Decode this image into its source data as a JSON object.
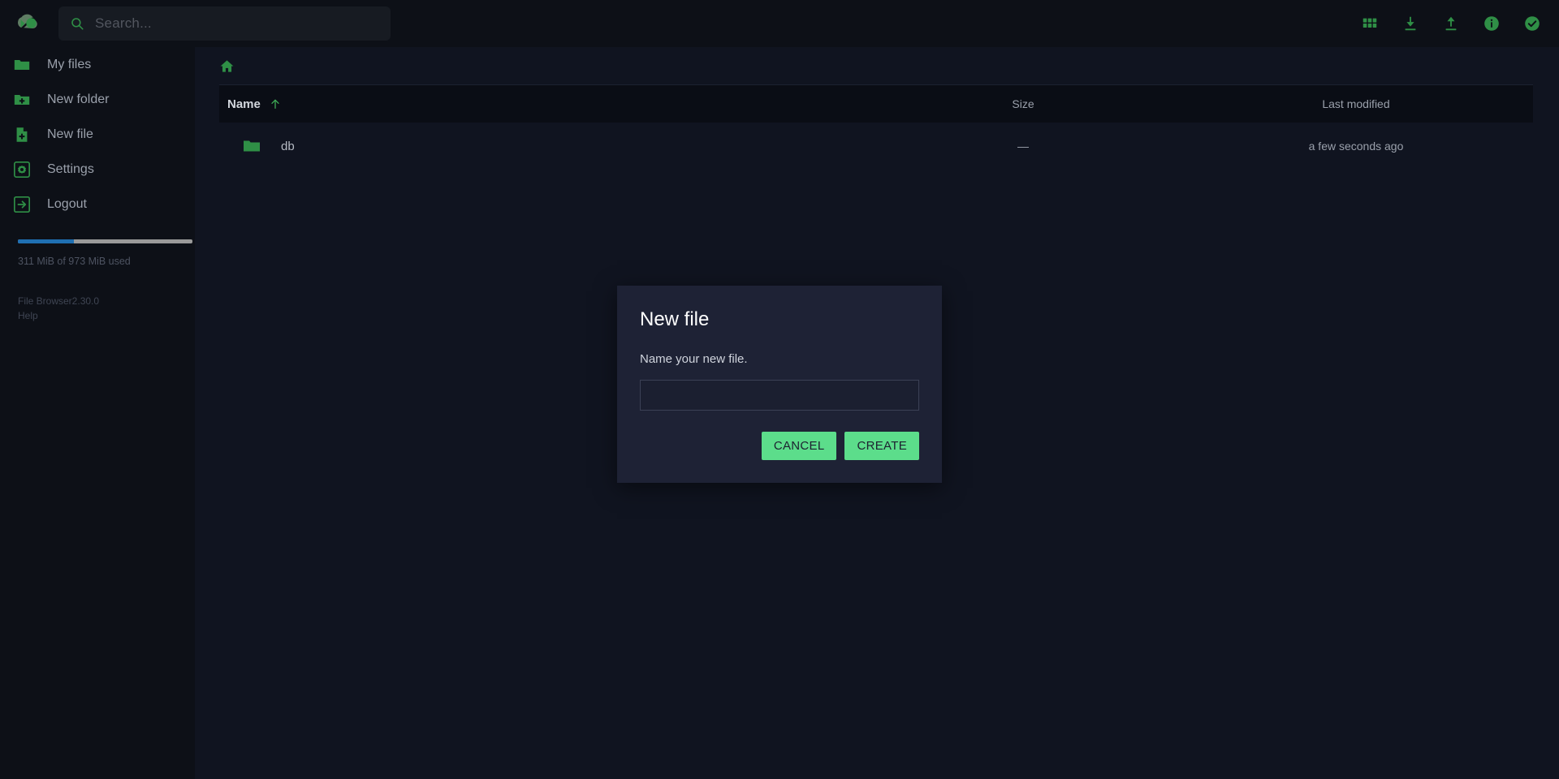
{
  "header": {
    "logo_name": "file-browser-logo",
    "search": {
      "placeholder": "Search...",
      "value": ""
    },
    "actions": [
      {
        "name": "switch-view-button",
        "icon": "grid-icon",
        "label": "Switch view"
      },
      {
        "name": "download-button",
        "icon": "download-icon",
        "label": "Download"
      },
      {
        "name": "upload-button",
        "icon": "upload-icon",
        "label": "Upload"
      },
      {
        "name": "info-button",
        "icon": "info-icon",
        "label": "Info"
      },
      {
        "name": "select-multiple-button",
        "icon": "check-circle-icon",
        "label": "Select multiple"
      }
    ]
  },
  "sidebar": {
    "items": [
      {
        "label": "My files",
        "icon": "folder-icon"
      },
      {
        "label": "New folder",
        "icon": "folder-plus-icon"
      },
      {
        "label": "New file",
        "icon": "file-plus-icon"
      },
      {
        "label": "Settings",
        "icon": "gear-icon"
      },
      {
        "label": "Logout",
        "icon": "logout-icon"
      }
    ],
    "storage": {
      "used_percent": 32,
      "text": "311 MiB of 973 MiB used",
      "track_color": "#9a9a9a",
      "fill_color": "#1f6fb2"
    },
    "footer": {
      "version": "File Browser2.30.0",
      "help": "Help"
    }
  },
  "main": {
    "breadcrumb": {
      "home_label": "Home"
    },
    "columns": {
      "name": "Name",
      "size": "Size",
      "modified": "Last modified"
    },
    "sort": {
      "column": "Name",
      "direction": "asc"
    },
    "rows": [
      {
        "name": "db",
        "icon": "folder-icon",
        "size": "—",
        "modified": "a few seconds ago"
      }
    ]
  },
  "modal": {
    "title": "New file",
    "prompt": "Name your new file.",
    "input": {
      "value": "",
      "placeholder": ""
    },
    "cancel_label": "CANCEL",
    "create_label": "CREATE",
    "button_color": "#5cdd8b"
  },
  "colors": {
    "accent_green": "#2f8f46",
    "bright_green": "#5cdd8b",
    "page_bg": "#0d1017",
    "panel_bg": "#101420",
    "modal_bg": "#1e2235"
  }
}
